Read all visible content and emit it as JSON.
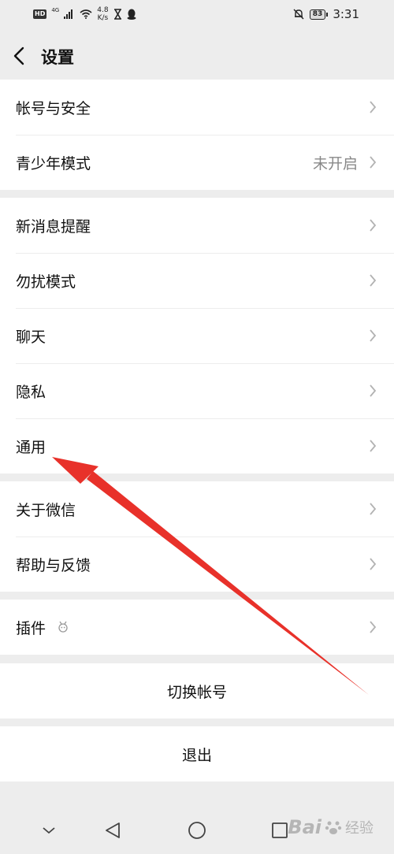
{
  "status_bar": {
    "hd": "HD",
    "network": "4G",
    "speed_value": "4.8",
    "speed_unit": "K/s",
    "battery": "83",
    "time": "3:31"
  },
  "header": {
    "title": "设置"
  },
  "groups": [
    {
      "items": [
        {
          "label": "帐号与安全",
          "value": ""
        },
        {
          "label": "青少年模式",
          "value": "未开启"
        }
      ]
    },
    {
      "items": [
        {
          "label": "新消息提醒"
        },
        {
          "label": "勿扰模式"
        },
        {
          "label": "聊天"
        },
        {
          "label": "隐私"
        },
        {
          "label": "通用"
        }
      ]
    },
    {
      "items": [
        {
          "label": "关于微信"
        },
        {
          "label": "帮助与反馈"
        }
      ]
    },
    {
      "items": [
        {
          "label": "插件"
        }
      ]
    }
  ],
  "actions": {
    "switch_account": "切换帐号",
    "logout": "退出"
  },
  "watermark": {
    "brand": "Bai",
    "sub": "经验"
  },
  "colors": {
    "background": "#ededed",
    "row_bg": "#ffffff",
    "annotation_arrow": "#e8312a"
  }
}
